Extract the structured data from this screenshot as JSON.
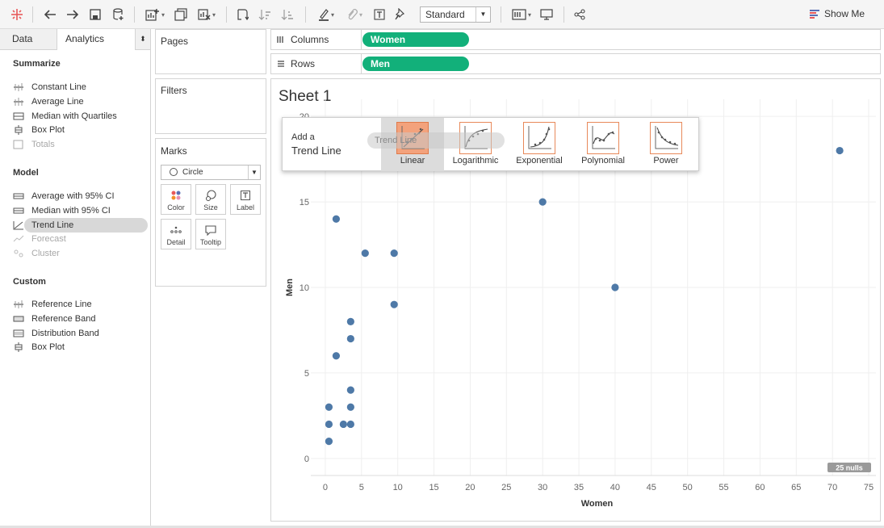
{
  "toolbar": {
    "mark_type": "Standard",
    "show_me": "Show Me",
    "accent_color": "#e8595a"
  },
  "left_pane": {
    "tabs": {
      "data": "Data",
      "analytics": "Analytics"
    },
    "sections": {
      "summarize": "Summarize",
      "model": "Model",
      "custom": "Custom"
    },
    "summarize_items": [
      {
        "label": "Constant Line",
        "icon": "constant-line-icon",
        "enabled": true
      },
      {
        "label": "Average Line",
        "icon": "average-line-icon",
        "enabled": true
      },
      {
        "label": "Median with Quartiles",
        "icon": "median-quartiles-icon",
        "enabled": true
      },
      {
        "label": "Box Plot",
        "icon": "box-plot-icon",
        "enabled": true
      },
      {
        "label": "Totals",
        "icon": "totals-icon",
        "enabled": false
      }
    ],
    "model_items": [
      {
        "label": "Average with 95% CI",
        "icon": "average-ci-icon",
        "enabled": true
      },
      {
        "label": "Median with 95% CI",
        "icon": "median-ci-icon",
        "enabled": true
      },
      {
        "label": "Trend Line",
        "icon": "trend-line-icon",
        "enabled": true,
        "selected": true
      },
      {
        "label": "Forecast",
        "icon": "forecast-icon",
        "enabled": false
      },
      {
        "label": "Cluster",
        "icon": "cluster-icon",
        "enabled": false
      }
    ],
    "custom_items": [
      {
        "label": "Reference Line",
        "icon": "reference-line-icon",
        "enabled": true
      },
      {
        "label": "Reference Band",
        "icon": "reference-band-icon",
        "enabled": true
      },
      {
        "label": "Distribution Band",
        "icon": "distribution-band-icon",
        "enabled": true
      },
      {
        "label": "Box Plot",
        "icon": "box-plot-icon",
        "enabled": true
      }
    ]
  },
  "cards": {
    "pages": "Pages",
    "filters": "Filters",
    "marks": "Marks",
    "mark_type": "Circle",
    "mark_buttons": [
      "Color",
      "Size",
      "Label",
      "Detail",
      "Tooltip"
    ]
  },
  "shelves": {
    "columns_label": "Columns",
    "columns_pill": "Women",
    "rows_label": "Rows",
    "rows_pill": "Men",
    "pill_color": "#12b07a"
  },
  "sheet": {
    "title": "Sheet 1",
    "nulls_badge": "25 nulls"
  },
  "trend_popup": {
    "add_a": "Add a",
    "trend_line": "Trend Line",
    "options": [
      "Linear",
      "Logarithmic",
      "Exponential",
      "Polynomial",
      "Power"
    ],
    "active_option": "Linear",
    "drag_ghost": "Trend Line"
  },
  "chart_data": {
    "type": "scatter",
    "xlabel": "Women",
    "ylabel": "Men",
    "xlim": [
      -2,
      76
    ],
    "ylim": [
      -1,
      21
    ],
    "xticks": [
      0,
      5,
      10,
      15,
      20,
      25,
      30,
      35,
      40,
      45,
      50,
      55,
      60,
      65,
      70,
      75
    ],
    "yticks": [
      0,
      5,
      10,
      15,
      20
    ],
    "grid": true,
    "point_color": "#4e79a7",
    "points": [
      [
        71,
        18
      ],
      [
        30,
        15
      ],
      [
        40,
        10
      ],
      [
        1.5,
        14
      ],
      [
        5.5,
        12
      ],
      [
        9.5,
        12
      ],
      [
        9.5,
        9
      ],
      [
        3.5,
        8
      ],
      [
        3.5,
        7
      ],
      [
        1.5,
        6
      ],
      [
        3.5,
        4
      ],
      [
        3.5,
        3
      ],
      [
        0.5,
        3
      ],
      [
        0.5,
        2
      ],
      [
        2.5,
        2
      ],
      [
        3.5,
        2
      ],
      [
        0.5,
        1
      ]
    ]
  }
}
